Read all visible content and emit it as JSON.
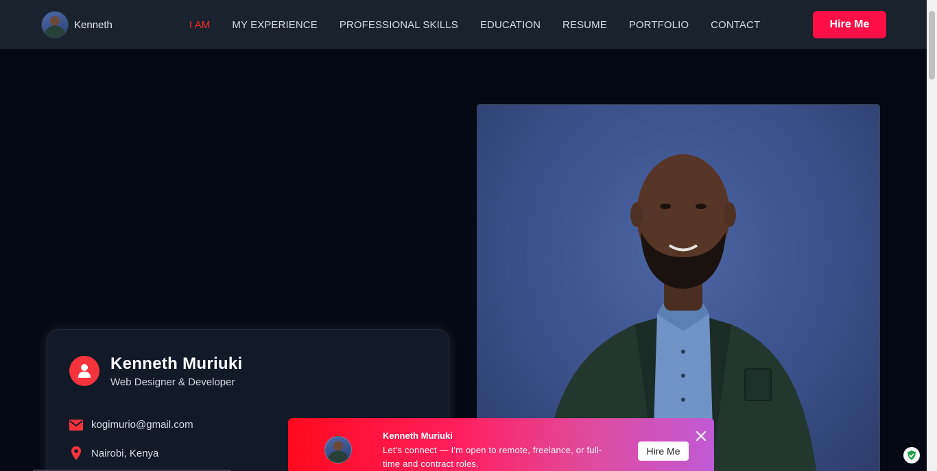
{
  "brand": {
    "name": "Kenneth"
  },
  "nav": {
    "items": [
      {
        "label": "I AM",
        "active": true
      },
      {
        "label": "MY EXPERIENCE",
        "active": false
      },
      {
        "label": "PROFESSIONAL SKILLS",
        "active": false
      },
      {
        "label": "EDUCATION",
        "active": false
      },
      {
        "label": "RESUME",
        "active": false
      },
      {
        "label": "PORTFOLIO",
        "active": false
      },
      {
        "label": "CONTACT",
        "active": false
      }
    ],
    "hire_label": "Hire Me"
  },
  "profile": {
    "name": "Kenneth Muriuki",
    "role": "Web Designer & Developer",
    "email": "kogimurio@gmail.com",
    "location": "Nairobi, Kenya",
    "icons": {
      "avatar": "user-icon",
      "email": "envelope-icon",
      "location": "map-pin-icon"
    }
  },
  "toast": {
    "title": "Kenneth Muriuki",
    "message": "Let's connect — I'm open to remote, freelance, or full-time and contract roles.",
    "button_label": "Hire Me",
    "close_icon": "close-icon"
  },
  "colors": {
    "accent": "#ff0f45",
    "active_nav": "#ff2a2a",
    "icon_red": "#f4333d",
    "background": "#050913",
    "navbar": "#19222d"
  }
}
